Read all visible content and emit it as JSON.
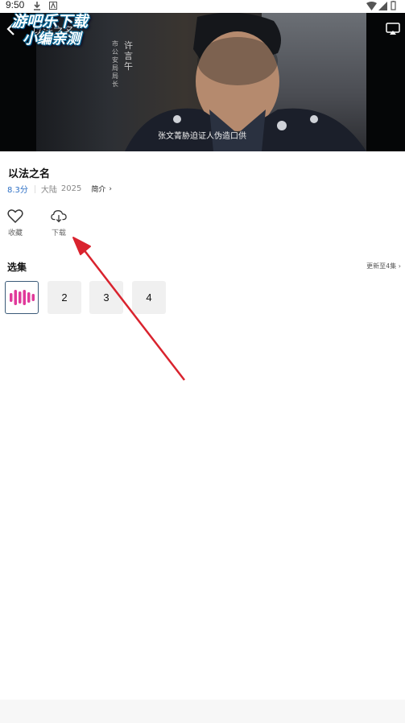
{
  "status_bar": {
    "time": "9:50"
  },
  "video": {
    "title": "以法之名",
    "watermark_line1": "游吧乐下载",
    "watermark_line2": "小编亲测",
    "on_screen_name": "许言午",
    "on_screen_role": "市公安局局长",
    "subtitle": "张文菁胁迫证人伪造口供"
  },
  "show": {
    "title": "以法之名",
    "score": "8.3分",
    "region": "大陆",
    "year": "2025",
    "intro_label": "简介"
  },
  "actions": [
    {
      "label": "收藏",
      "icon": "heart-icon"
    },
    {
      "label": "下载",
      "icon": "cloud-download-icon"
    }
  ],
  "episodes": {
    "heading": "选集",
    "more": "更新至4集",
    "items": [
      "2",
      "3",
      "4"
    ]
  },
  "colors": {
    "accent": "#2d6fc5",
    "playing_bars": "#e0399a",
    "annotation_arrow": "#d9232e"
  }
}
